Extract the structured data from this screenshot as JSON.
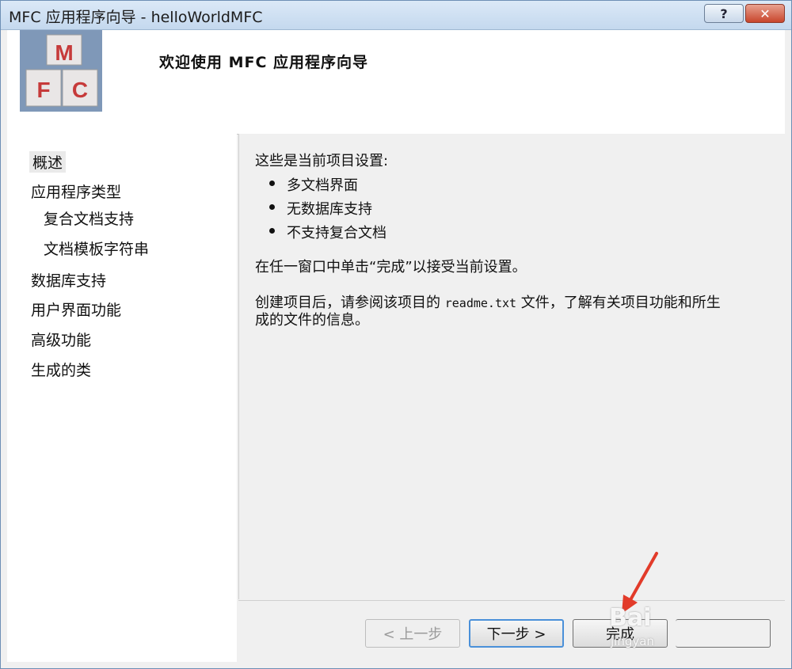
{
  "window": {
    "title": "MFC 应用程序向导 - helloWorldMFC"
  },
  "titlebar": {
    "help_label": "?",
    "close_label": "✕"
  },
  "banner": {
    "title": "欢迎使用 MFC 应用程序向导",
    "logo_letters": [
      "M",
      "F",
      "C"
    ]
  },
  "nav": {
    "items": [
      {
        "label": "概述"
      },
      {
        "label": "应用程序类型"
      },
      {
        "label": "复合文档支持"
      },
      {
        "label": "文档模板字符串"
      },
      {
        "label": "数据库支持"
      },
      {
        "label": "用户界面功能"
      },
      {
        "label": "高级功能"
      },
      {
        "label": "生成的类"
      }
    ]
  },
  "content": {
    "heading": "这些是当前项目设置:",
    "settings": [
      "多文档界面",
      "无数据库支持",
      "不支持复合文档"
    ],
    "finish_hint": "在任一窗口中单击“完成”以接受当前设置。",
    "after_create_1a": "创建项目后，请参阅该项目的 ",
    "readme": "readme.txt",
    "after_create_1b": " 文件，了解有关项目功能和所生",
    "after_create_2": "成的文件的信息。"
  },
  "buttons": {
    "prev": "< 上一步",
    "next": "下一步 >",
    "finish": "完成"
  },
  "watermark": {
    "main": "Bai",
    "sub": "jingyan"
  },
  "colors": {
    "accent": "#4a90d9",
    "annotation_arrow": "#e23b2a"
  }
}
